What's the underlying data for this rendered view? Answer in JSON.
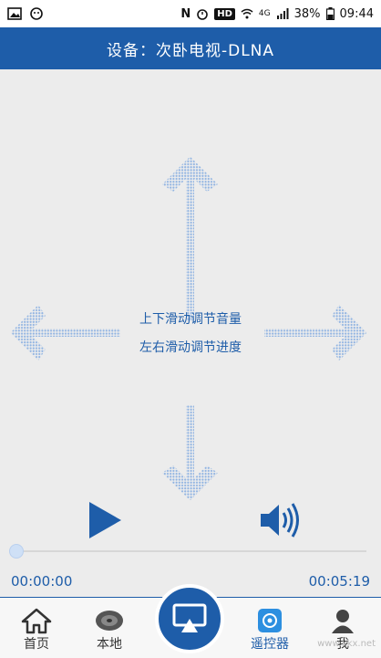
{
  "status_bar": {
    "battery": "38%",
    "time": "09:44",
    "network": "4G",
    "hd_badge": "HD",
    "n_badge": "N"
  },
  "header": {
    "title": "设备：次卧电视-DLNA"
  },
  "gesture_hint": {
    "line1": "上下滑动调节音量",
    "line2": "左右滑动调节进度"
  },
  "player": {
    "current_time": "00:00:00",
    "total_time": "00:05:19",
    "progress": 0
  },
  "bottom_nav": {
    "items": [
      {
        "label": "首页",
        "icon": "home-icon"
      },
      {
        "label": "本地",
        "icon": "disk-icon"
      },
      {
        "label": "遥控器",
        "icon": "remote-icon"
      },
      {
        "label": "我",
        "icon": "user-icon"
      }
    ],
    "center_icon": "cast-icon"
  },
  "watermark": "www.kkx.net",
  "colors": {
    "primary": "#1e5da9",
    "arrow": "#9fc0e8",
    "background": "#ececec"
  }
}
